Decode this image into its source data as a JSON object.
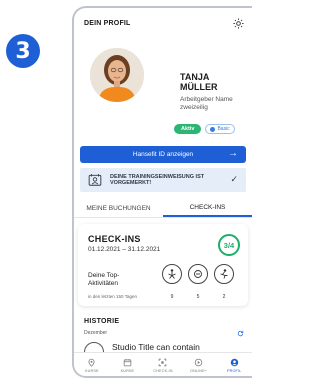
{
  "step_number": "3",
  "header": {
    "title": "DEIN PROFIL",
    "settings_icon": "gear-icon"
  },
  "profile": {
    "first_name": "TANJA",
    "last_name": "MÜLLER",
    "role": "Arbeitgeber Name zweizeilig",
    "status_active": "Aktiv",
    "status_plan": "Basic"
  },
  "id_button": {
    "label": "Hansefit ID anzeigen",
    "arrow": "→"
  },
  "notice": {
    "text": "DEINE TRAININGSEINWEISUNG IST VORGEMERKT!",
    "check": "✓"
  },
  "tabs": [
    {
      "label": "MEINE BUCHUNGEN",
      "active": false
    },
    {
      "label": "CHECK-INS",
      "active": true
    }
  ],
  "checkins": {
    "title": "CHECK-INS",
    "date_range": "01.12.2021 – 31.12.2021",
    "ratio": "3/4",
    "top_label": "Deine Top-Aktivitäten",
    "period": "in den letzten 150 Tagen",
    "activities": [
      {
        "icon": "yoga-icon",
        "count": "9"
      },
      {
        "icon": "fitness-icon",
        "count": "5"
      },
      {
        "icon": "workout-icon",
        "count": "2"
      }
    ]
  },
  "history": {
    "title": "HISTORIE",
    "month": "Dezember",
    "studio_title": "Studio Title can contain"
  },
  "bottom_nav": [
    {
      "label": "KURSE",
      "icon": "location-pin-icon",
      "active": false
    },
    {
      "label": "KURSE",
      "icon": "calendar-icon",
      "active": false
    },
    {
      "label": "CHECK-IN",
      "icon": "qr-code-icon",
      "active": false
    },
    {
      "label": "ONLINE+",
      "icon": "play-icon",
      "active": false
    },
    {
      "label": "PROFIL",
      "icon": "profile-icon",
      "active": true
    }
  ],
  "colors": {
    "primary": "#1f5fd6",
    "active_tag": "#2cb673",
    "ring": "#1fae6a",
    "notice_bg": "#e4edf8"
  }
}
